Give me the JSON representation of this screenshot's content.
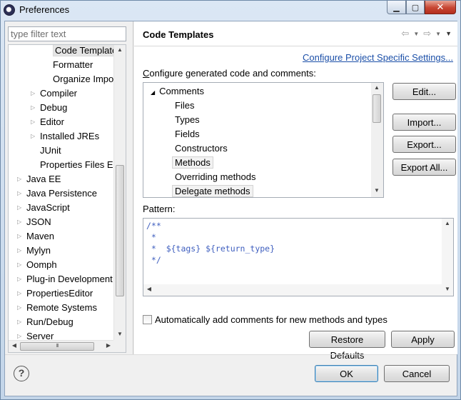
{
  "window": {
    "title": "Preferences",
    "minimize_glyph": "▁",
    "maximize_glyph": "▢",
    "close_glyph": "✕"
  },
  "filter": {
    "placeholder": "type filter text"
  },
  "tree": {
    "items": [
      {
        "label": "Code Template",
        "indent": 2,
        "arrow": "",
        "selected": true
      },
      {
        "label": "Formatter",
        "indent": 2,
        "arrow": ""
      },
      {
        "label": "Organize Impo",
        "indent": 2,
        "arrow": ""
      },
      {
        "label": "Compiler",
        "indent": 1,
        "arrow": "▷"
      },
      {
        "label": "Debug",
        "indent": 1,
        "arrow": "▷"
      },
      {
        "label": "Editor",
        "indent": 1,
        "arrow": "▷"
      },
      {
        "label": "Installed JREs",
        "indent": 1,
        "arrow": "▷"
      },
      {
        "label": "JUnit",
        "indent": 1,
        "arrow": ""
      },
      {
        "label": "Properties Files Ed",
        "indent": 1,
        "arrow": ""
      },
      {
        "label": "Java EE",
        "indent": 0,
        "arrow": "▷"
      },
      {
        "label": "Java Persistence",
        "indent": 0,
        "arrow": "▷"
      },
      {
        "label": "JavaScript",
        "indent": 0,
        "arrow": "▷"
      },
      {
        "label": "JSON",
        "indent": 0,
        "arrow": "▷"
      },
      {
        "label": "Maven",
        "indent": 0,
        "arrow": "▷"
      },
      {
        "label": "Mylyn",
        "indent": 0,
        "arrow": "▷"
      },
      {
        "label": "Oomph",
        "indent": 0,
        "arrow": "▷"
      },
      {
        "label": "Plug-in Development",
        "indent": 0,
        "arrow": "▷"
      },
      {
        "label": "PropertiesEditor",
        "indent": 0,
        "arrow": "▷"
      },
      {
        "label": "Remote Systems",
        "indent": 0,
        "arrow": "▷"
      },
      {
        "label": "Run/Debug",
        "indent": 0,
        "arrow": "▷"
      },
      {
        "label": "Server",
        "indent": 0,
        "arrow": "▷"
      }
    ],
    "hscroll_grip": "III"
  },
  "page": {
    "title": "Code Templates",
    "config_link": "Configure Project Specific Settings...",
    "section_label": "Configure generated code and comments:",
    "pattern_label": "Pattern:",
    "pattern_lines": [
      "/**",
      " *",
      " *  ${tags} ${return_type}",
      " */"
    ],
    "checkbox_label": "Automatically add comments for new methods and types",
    "checkbox_checked": false
  },
  "templates": {
    "group": "Comments",
    "items": [
      {
        "label": "Files"
      },
      {
        "label": "Types"
      },
      {
        "label": "Fields"
      },
      {
        "label": "Constructors"
      },
      {
        "label": "Methods",
        "highlight": true
      },
      {
        "label": "Overriding methods"
      },
      {
        "label": "Delegate methods",
        "highlight": true
      }
    ]
  },
  "buttons": {
    "edit": "Edit...",
    "import": "Import...",
    "export": "Export...",
    "export_all": "Export All...",
    "restore_defaults": "Restore Defaults",
    "apply": "Apply",
    "ok": "OK",
    "cancel": "Cancel"
  },
  "help": {
    "glyph": "?"
  }
}
